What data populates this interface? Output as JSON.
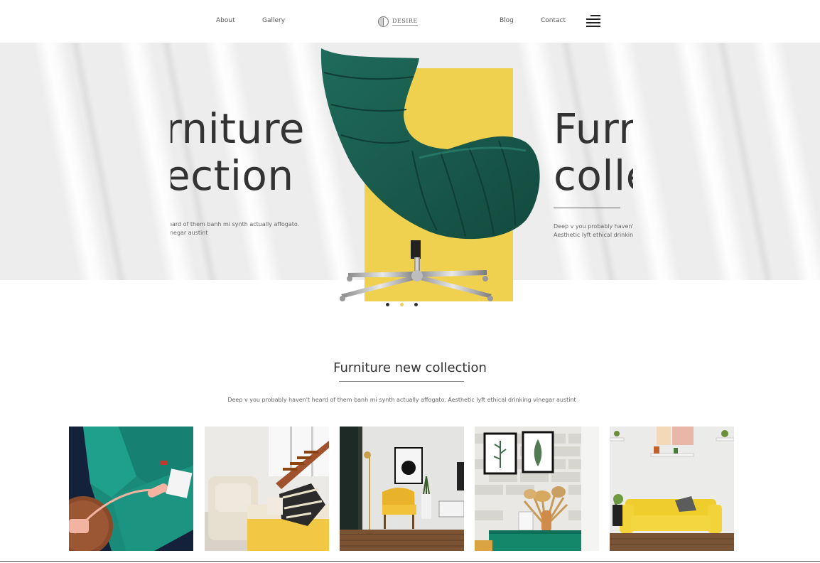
{
  "nav": {
    "left": [
      "About",
      "Gallery"
    ],
    "right": [
      "Blog",
      "Contact"
    ],
    "logo_text": "DESIRE",
    "logo_icon": "half-circle-logo-icon",
    "menu_icon": "hamburger-menu-icon"
  },
  "hero": {
    "slide_prev": {
      "line1": "rniture",
      "line2": "ection",
      "text1": "heard of them banh mi synth actually affogato.",
      "text2": "vinegar austint"
    },
    "slide_next": {
      "line1": "Furr",
      "line2": "colle",
      "text1": "Deep v you probably haven't h",
      "text2": "Aesthetic lyft ethical drinking v"
    },
    "image": "green-leather-lounge-chair",
    "accent_color": "#f0d14f",
    "dots": 3,
    "active_dot": 2
  },
  "collection": {
    "title": "Furniture new collection",
    "subtitle": "Deep v you probably haven't heard of them banh mi synth actually affogato. Aesthetic lyft ethical drinking vinegar austint",
    "tiles": [
      "teal-velvet-sofa-with-telephone",
      "beige-armchair-yellow-sofa-stairs",
      "yellow-armchair-floor-lamp",
      "green-sideboard-dried-flowers",
      "yellow-sofa-white-wall"
    ]
  }
}
